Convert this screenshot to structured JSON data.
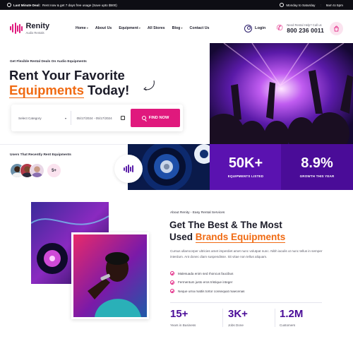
{
  "topbar": {
    "deal_label": "Last Minute Deal:",
    "deal_text": "Rent now & get 7 days free usage (Save upto $500)",
    "hours": "Monday to Saturday",
    "hours_time": "9am to 5pm"
  },
  "brand": {
    "name": "Renity",
    "tagline": "Audio Rentals",
    "accent": "#e0197d"
  },
  "nav": {
    "items": [
      "Home",
      "About Us",
      "Equipment",
      "All Stores",
      "Blog",
      "Contact Us"
    ]
  },
  "header": {
    "login": "Login",
    "help_label": "Need Rental Help? Call us",
    "phone": "800 236 0011"
  },
  "hero": {
    "subtitle": "Get Flexible Rental Deals On Audio Equipments",
    "title_line1": "Rent Your Favorite",
    "title_accent": "Equipments",
    "title_rest": " Today!",
    "category_placeholder": "Select Category",
    "date_range": "05/17/2024 - 05/17/2024",
    "find_button": "FIND NOW"
  },
  "users": {
    "label": "Users That Recently Rent Equipments",
    "more": "5+"
  },
  "stats": [
    {
      "value": "50K+",
      "label": "EQUIPMENTS LISTED",
      "color": "#5a12b0"
    },
    {
      "value": "8.9%",
      "label": "GROWTH THIS YEAR",
      "color": "#4a0c98"
    }
  ],
  "about": {
    "subtitle": "About Renity - Easy Rental Services",
    "title_line1": "Get The Best & The Most",
    "title_prefix": "Used ",
    "title_accent": "Brands Equipments",
    "description": "Cursus ullamcorper ultricies amet imperdiet amet nunc volutpat nunc. Nibh iaculis ut nunc tellus in semper interdum. Ant donec diam suspendisse. Sit vitae non tellus aliquam.",
    "checks": [
      "Malesuada enim sed rhoncus faucibus",
      "Fermentum justo eros tristique integer",
      "Neque urna mattis tortor consequat maecenas"
    ],
    "kpis": [
      {
        "value": "15+",
        "label": "Years in Business"
      },
      {
        "value": "3K+",
        "label": "Jobs Done"
      },
      {
        "value": "1.2M",
        "label": "Customers"
      }
    ]
  }
}
